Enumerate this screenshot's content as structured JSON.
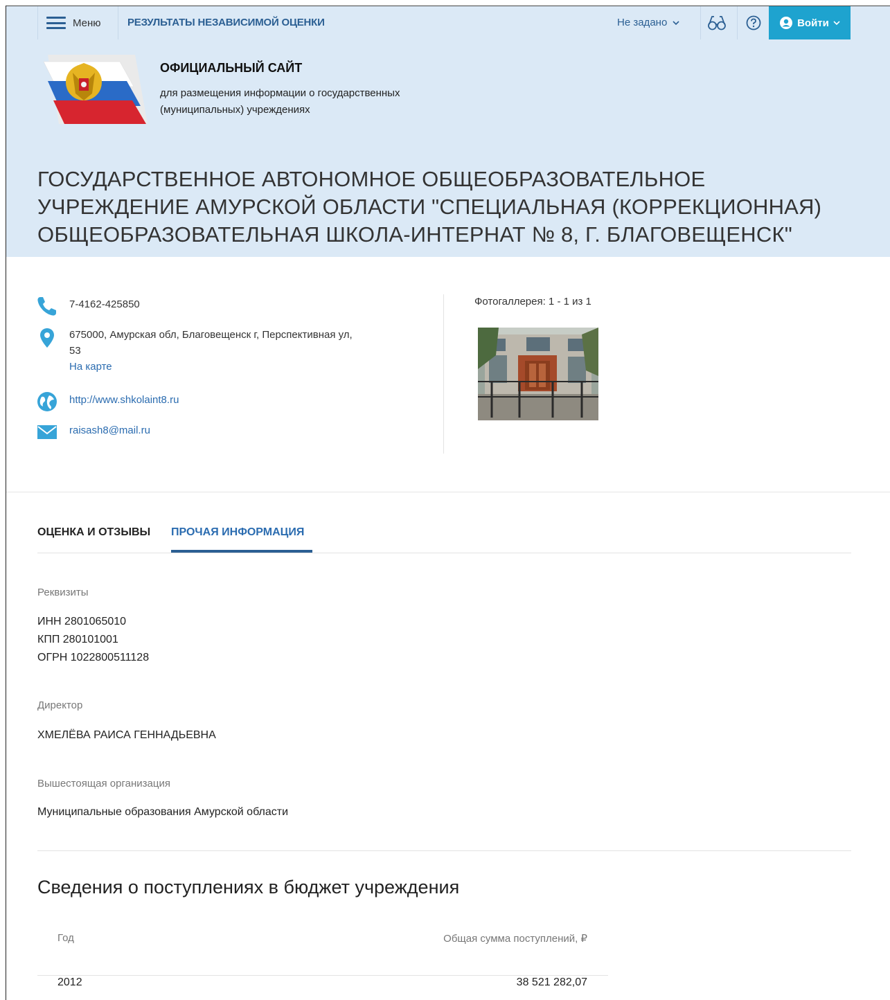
{
  "topbar": {
    "menu_label": "Меню",
    "section_title": "РЕЗУЛЬТАТЫ НЕЗАВИСИМОЙ ОЦЕНКИ",
    "region_select": "Не задано",
    "login_label": "Войти"
  },
  "site": {
    "name": "ОФИЦИАЛЬНЫЙ САЙТ",
    "desc_line1": "для размещения информации о государственных",
    "desc_line2": "(муниципальных) учреждениях"
  },
  "org": {
    "title_line1": "ГОСУДАРСТВЕННОЕ АВТОНОМНОЕ ОБЩЕОБРАЗОВАТЕЛЬНОЕ",
    "title_line2": "УЧРЕЖДЕНИЕ АМУРСКОЙ ОБЛАСТИ \"СПЕЦИАЛЬНАЯ (КОРРЕКЦИОННАЯ)",
    "title_line3": "ОБЩЕОБРАЗОВАТЕЛЬНАЯ ШКОЛА-ИНТЕРНАТ № 8, Г. БЛАГОВЕЩЕНСК\""
  },
  "contacts": {
    "phone": "7-4162-425850",
    "address_line1": "675000, Амурская обл, Благовещенск г, Перспективная ул,",
    "address_line2": "53",
    "map_link": "На карте",
    "website": "http://www.shkolaint8.ru",
    "email": "raisash8@mail.ru"
  },
  "gallery": {
    "label": "Фотогаллерея: 1 - 1 из 1"
  },
  "tabs": [
    {
      "label": "ОЦЕНКА И ОТЗЫВЫ",
      "active": false
    },
    {
      "label": "ПРОЧАЯ ИНФОРМАЦИЯ",
      "active": true
    }
  ],
  "details": {
    "requisites_label": "Реквизиты",
    "inn": "ИНН 2801065010",
    "kpp": "КПП 280101001",
    "ogrn": "ОГРН 1022800511128",
    "director_label": "Директор",
    "director": "ХМЕЛЁВА РАИСА ГЕННАДЬЕВНА",
    "parent_label": "Вышестоящая организация",
    "parent": "Муниципальные образования Амурской области"
  },
  "budget": {
    "title": "Сведения о поступлениях в бюджет учреждения",
    "col_year": "Год",
    "col_sum": "Общая сумма поступлений, ₽",
    "rows": [
      {
        "year": "2012",
        "sum": "38 521 282,07"
      }
    ]
  },
  "colors": {
    "topbar_bg": "#dbe9f6",
    "accent": "#2b5f93",
    "login_bg": "#1ea3cf",
    "link": "#2b6cb0",
    "icon_blue": "#37a4d8"
  }
}
